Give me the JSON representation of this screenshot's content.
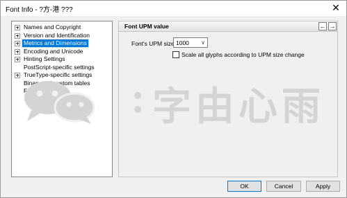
{
  "window": {
    "title": "Font Info - ?方-港 ???"
  },
  "titlebar": {
    "close_glyph": "✕"
  },
  "sidebar": {
    "items": [
      {
        "label": "Names and Copyright",
        "expandable": true,
        "selected": false
      },
      {
        "label": "Version and Identification",
        "expandable": true,
        "selected": false
      },
      {
        "label": "Metrics and Dimensions",
        "expandable": true,
        "selected": true
      },
      {
        "label": "Encoding and Unicode",
        "expandable": true,
        "selected": false
      },
      {
        "label": "Hinting Settings",
        "expandable": true,
        "selected": false
      },
      {
        "label": "PostScript-specific settings",
        "expandable": false,
        "selected": false
      },
      {
        "label": "TrueType-specific settings",
        "expandable": true,
        "selected": false
      },
      {
        "label": "Binary and custom tables",
        "expandable": false,
        "selected": false
      },
      {
        "label": "Font note",
        "expandable": false,
        "selected": false
      }
    ]
  },
  "panel": {
    "title": "Font UPM value",
    "prev_glyph": "←",
    "next_glyph": "→",
    "upm_label": "Font's UPM size:",
    "upm_value": "1000",
    "dropdown_glyph": "∨",
    "scale_label": "Scale all glyphs according to UPM size change",
    "scale_checked": false
  },
  "buttons": {
    "ok": "OK",
    "cancel": "Cancel",
    "apply": "Apply"
  },
  "watermark": {
    "text": "字由心雨",
    "icon": "wechat-icon"
  },
  "colors": {
    "selection": "#0078d7",
    "watermark": "#d4d4d4"
  }
}
